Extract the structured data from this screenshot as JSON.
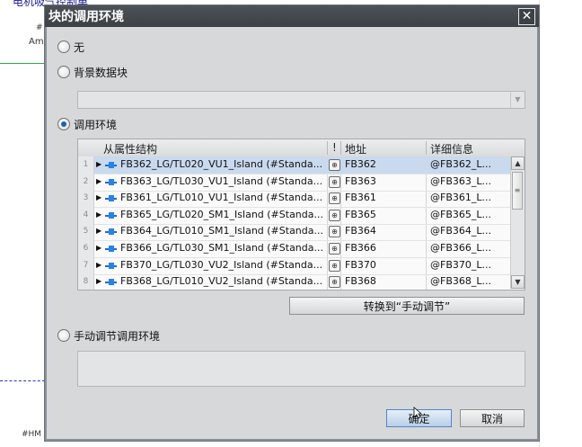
{
  "background": {
    "top_text": "电机吸气控制单",
    "hash_label": "#",
    "am_label": "Am",
    "bottom_label": "#HM"
  },
  "dialog": {
    "title": "块的调用环境",
    "close_glyph": "✕"
  },
  "options": {
    "none_label": "无",
    "instance_db_label": "背景数据块",
    "call_env_label": "调用环境",
    "manual_env_label": "手动调节调用环境",
    "selected": "call_env"
  },
  "table": {
    "columns": [
      "从属性结构",
      "!",
      "地址",
      "详细信息"
    ],
    "rows": [
      {
        "num": "1",
        "struct": "FB362_LG/TL020_VU1_Island (#Standa...",
        "addr": "FB362",
        "detail": "@FB362_L..."
      },
      {
        "num": "2",
        "struct": "FB363_LG/TL030_VU1_Island (#Standa...",
        "addr": "FB363",
        "detail": "@FB363_L..."
      },
      {
        "num": "3",
        "struct": "FB361_LG/TL010_VU1_Island (#Standa...",
        "addr": "FB361",
        "detail": "@FB361_L..."
      },
      {
        "num": "4",
        "struct": "FB365_LG/TL020_SM1_Island (#Standa...",
        "addr": "FB365",
        "detail": "@FB365_L..."
      },
      {
        "num": "5",
        "struct": "FB364_LG/TL010_SM1_Island (#Standa...",
        "addr": "FB364",
        "detail": "@FB364_L..."
      },
      {
        "num": "6",
        "struct": "FB366_LG/TL030_SM1_Island (#Standa...",
        "addr": "FB366",
        "detail": "@FB366_L..."
      },
      {
        "num": "7",
        "struct": "FB370_LG/TL030_VU2_Island (#Standa...",
        "addr": "FB370",
        "detail": "@FB370_L..."
      },
      {
        "num": "8",
        "struct": "FB368_LG/TL010_VU2_Island (#Standa...",
        "addr": "FB368",
        "detail": "@FB368_L..."
      }
    ],
    "selected_row": 0
  },
  "buttons": {
    "convert_label": "转换到“手动调节”",
    "ok_label": "确定",
    "cancel_label": "取消"
  },
  "colors": {
    "title_bar": "#3b4146",
    "dialog_body": "#d6d8d9",
    "selected_row": "#c9d9ee",
    "radio_dot": "#1e5fae"
  }
}
